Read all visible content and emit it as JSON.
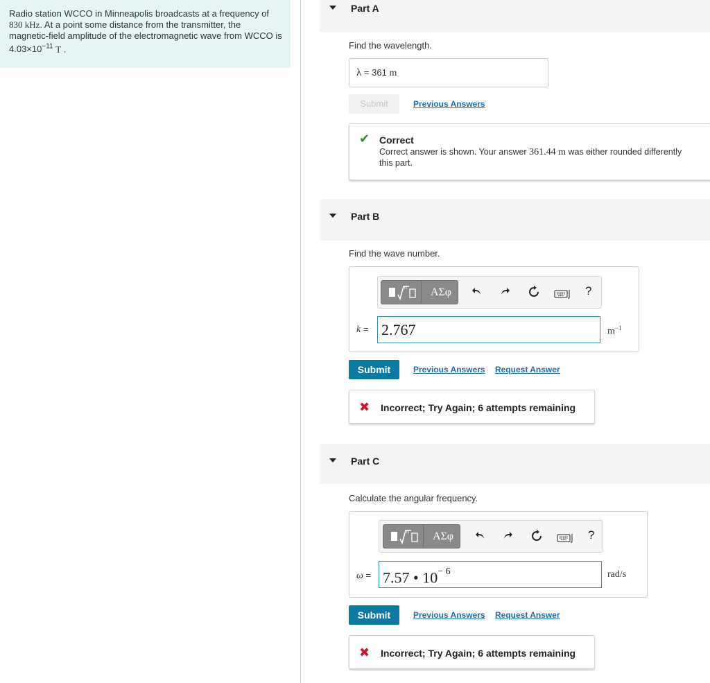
{
  "problem": {
    "text_1": "Radio station WCCO in Minneapolis broadcasts at a frequency of",
    "frequency": "830 kHz",
    "text_2": ". At a point some distance from the transmitter, the magnetic-field amplitude of the electromagnetic wave from WCCO is",
    "amplitude_prefix": "4.03×10",
    "amplitude_exp": "−11",
    "amplitude_unit": "T",
    "text_end": "."
  },
  "partA": {
    "title": "Part A",
    "prompt": "Find the wavelength.",
    "answer_symbol": "λ",
    "answer_eq": "=",
    "answer_value": "361",
    "answer_unit": "m",
    "submit_label": "Submit",
    "previous_answers": "Previous Answers",
    "feedback_title": "Correct",
    "feedback_text_1": "Correct answer is shown. Your answer",
    "feedback_value": "361.44 m",
    "feedback_text_2": "was either rounded differently",
    "feedback_text_3": "this part."
  },
  "partB": {
    "title": "Part B",
    "prompt": "Find the wave number.",
    "toolbar_greek": "ΑΣφ",
    "help": "?",
    "var_label": "k =",
    "input_value": "2.767",
    "unit_base": "m",
    "unit_exp": "−1",
    "submit_label": "Submit",
    "previous_answers": "Previous Answers",
    "request_answer": "Request Answer",
    "feedback": "Incorrect; Try Again; 6 attempts remaining"
  },
  "partC": {
    "title": "Part C",
    "prompt": "Calculate the angular frequency.",
    "toolbar_greek": "ΑΣφ",
    "help": "?",
    "var_label": "ω =",
    "input_base": "7.57 • 10",
    "input_exp": "− 6",
    "unit": "rad/s",
    "submit_label": "Submit",
    "previous_answers": "Previous Answers",
    "request_answer": "Request Answer",
    "feedback": "Incorrect; Try Again; 6 attempts remaining"
  },
  "colors": {
    "accent": "#0a7aa0",
    "link": "#1a6fae",
    "correct": "#2e8b2e",
    "incorrect": "#d0112b",
    "problem_bg": "#e6f4f6"
  },
  "icons": [
    "collapse-triangle-icon",
    "template-sqrt-icon",
    "greek-symbols-icon",
    "undo-icon",
    "redo-icon",
    "reset-icon",
    "keyboard-icon",
    "help-icon",
    "checkmark-icon",
    "x-icon"
  ]
}
